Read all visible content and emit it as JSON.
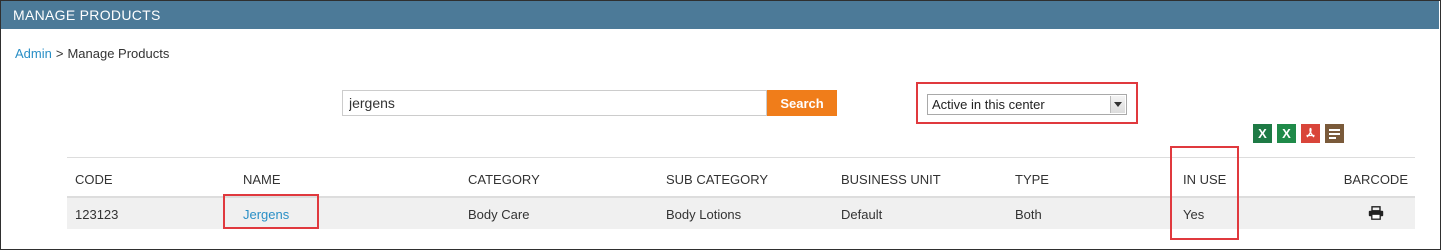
{
  "header": {
    "title": "MANAGE PRODUCTS"
  },
  "breadcrumb": {
    "root": "Admin",
    "separator": ">",
    "current": "Manage Products"
  },
  "search": {
    "value": "jergens",
    "button_label": "Search"
  },
  "filter": {
    "selected": "Active in this center"
  },
  "export_icons": [
    {
      "name": "excel-icon",
      "glyph": "X",
      "color": "#1e7a45"
    },
    {
      "name": "excel-alt-icon",
      "glyph": "X",
      "color": "#1f8a49"
    },
    {
      "name": "pdf-icon",
      "glyph": "A",
      "color": "#d9453a"
    },
    {
      "name": "text-doc-icon",
      "glyph": "≡",
      "color": "#7a5a3a"
    }
  ],
  "table": {
    "columns": [
      "CODE",
      "NAME",
      "CATEGORY",
      "SUB CATEGORY",
      "BUSINESS UNIT",
      "TYPE",
      "IN USE",
      "BARCODE"
    ],
    "rows": [
      {
        "code": "123123",
        "name": "Jergens",
        "category": "Body Care",
        "sub_category": "Body Lotions",
        "business_unit": "Default",
        "type": "Both",
        "in_use": "Yes",
        "barcode_icon": "printer-icon"
      }
    ]
  },
  "colors": {
    "header_bg": "#4c7a98",
    "link": "#2a8fc6",
    "search_button": "#f07d1a",
    "highlight": "#e0393e"
  }
}
